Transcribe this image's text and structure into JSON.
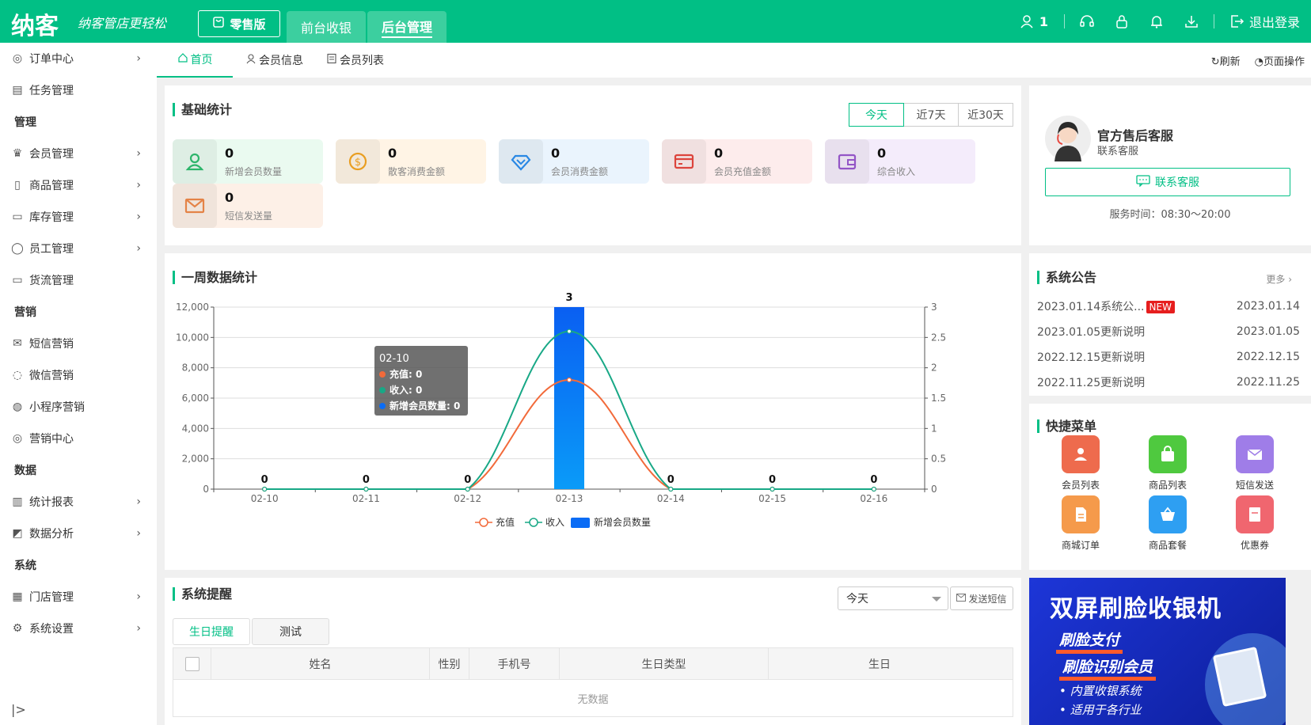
{
  "header": {
    "logo": "纳客",
    "slogan": "纳客管店更轻松",
    "edition": "零售版",
    "nav": [
      "前台收银",
      "后台管理"
    ],
    "user_count": "1",
    "logout": "退出登录"
  },
  "sidebar": {
    "items": [
      {
        "type": "item",
        "label": "订单中心",
        "arrow": true,
        "icon": "globe-icon"
      },
      {
        "type": "item",
        "label": "任务管理",
        "arrow": false,
        "icon": "task-icon"
      },
      {
        "type": "group",
        "label": "管理"
      },
      {
        "type": "item",
        "label": "会员管理",
        "arrow": true,
        "icon": "crown-icon"
      },
      {
        "type": "item",
        "label": "商品管理",
        "arrow": true,
        "icon": "goods-icon"
      },
      {
        "type": "item",
        "label": "库存管理",
        "arrow": true,
        "icon": "inventory-icon"
      },
      {
        "type": "item",
        "label": "员工管理",
        "arrow": true,
        "icon": "staff-icon"
      },
      {
        "type": "item",
        "label": "货流管理",
        "arrow": false,
        "icon": "truck-icon"
      },
      {
        "type": "group",
        "label": "营销"
      },
      {
        "type": "item",
        "label": "短信营销",
        "arrow": false,
        "icon": "mail-icon"
      },
      {
        "type": "item",
        "label": "微信营销",
        "arrow": false,
        "icon": "wechat-icon"
      },
      {
        "type": "item",
        "label": "小程序营销",
        "arrow": false,
        "icon": "miniapp-icon"
      },
      {
        "type": "item",
        "label": "营销中心",
        "arrow": false,
        "icon": "target-icon"
      },
      {
        "type": "group",
        "label": "数据"
      },
      {
        "type": "item",
        "label": "统计报表",
        "arrow": true,
        "icon": "bar-chart-icon"
      },
      {
        "type": "item",
        "label": "数据分析",
        "arrow": true,
        "icon": "analysis-icon"
      },
      {
        "type": "group",
        "label": "系统"
      },
      {
        "type": "item",
        "label": "门店管理",
        "arrow": true,
        "icon": "store-icon"
      },
      {
        "type": "item",
        "label": "系统设置",
        "arrow": true,
        "icon": "gear-icon"
      }
    ]
  },
  "tabs": {
    "home": "首页",
    "member_info": "会员信息",
    "member_list": "会员列表",
    "refresh": "刷新",
    "page_ops": "页面操作"
  },
  "basic_stats": {
    "title": "基础统计",
    "ranges": [
      "今天",
      "近7天",
      "近30天"
    ],
    "active_range": "今天",
    "items": [
      {
        "value": "0",
        "label": "新增会员数量",
        "color": "#2fbf71",
        "bg": "#eafaf0"
      },
      {
        "value": "0",
        "label": "散客消费金额",
        "color": "#f5a623",
        "bg": "#fff4e5"
      },
      {
        "value": "0",
        "label": "会员消费金额",
        "color": "#2b8ff0",
        "bg": "#eaf4fd"
      },
      {
        "value": "0",
        "label": "会员充值金额",
        "color": "#e8483f",
        "bg": "#fdecec"
      },
      {
        "value": "0",
        "label": "综合收入",
        "color": "#9b59d0",
        "bg": "#f4ecfb"
      },
      {
        "value": "0",
        "label": "短信发送量",
        "color": "#f08a4b",
        "bg": "#fdf0e7"
      }
    ]
  },
  "service": {
    "title": "官方售后客服",
    "subtitle": "联系客服",
    "button": "联系客服",
    "hours": "服务时间：08:30～20:00"
  },
  "chart_data": {
    "type": "bar",
    "title": "一周数据统计",
    "categories": [
      "02-10",
      "02-11",
      "02-12",
      "02-13",
      "02-14",
      "02-15",
      "02-16"
    ],
    "series": [
      {
        "name": "充值",
        "kind": "line",
        "axis": "left",
        "color": "#f26a3a",
        "values": [
          0,
          0,
          0,
          7200,
          0,
          0,
          0
        ]
      },
      {
        "name": "收入",
        "kind": "line",
        "axis": "left",
        "color": "#18a886",
        "values": [
          0,
          0,
          0,
          10400,
          0,
          0,
          0
        ]
      },
      {
        "name": "新增会员数量",
        "kind": "bar",
        "axis": "right",
        "color": "#0a6cf5",
        "values": [
          0,
          0,
          0,
          3,
          0,
          0,
          0
        ]
      }
    ],
    "ylim_left": [
      0,
      12000
    ],
    "yticks_left": [
      "0",
      "2,000",
      "4,000",
      "6,000",
      "8,000",
      "10,000",
      "12,000"
    ],
    "ylim_right": [
      0,
      3
    ],
    "yticks_right": [
      "0",
      "0.5",
      "1",
      "1.5",
      "2",
      "2.5",
      "3"
    ],
    "grid": true,
    "legend": "bottom",
    "tooltip": {
      "title": "02-10",
      "rows": [
        "充值: 0",
        "收入: 0",
        "新增会员数量: 0"
      ]
    }
  },
  "notices": {
    "title": "系统公告",
    "more": "更多 ›",
    "new_badge": "NEW",
    "items": [
      {
        "title": "2023.01.14系统公...",
        "date": "2023.01.14",
        "is_new": true
      },
      {
        "title": "2023.01.05更新说明",
        "date": "2023.01.05",
        "is_new": false
      },
      {
        "title": "2022.12.15更新说明",
        "date": "2022.12.15",
        "is_new": false
      },
      {
        "title": "2022.11.25更新说明",
        "date": "2022.11.25",
        "is_new": false
      }
    ]
  },
  "quick_menu": {
    "title": "快捷菜单",
    "items": [
      {
        "label": "会员列表",
        "color": "#ee6b4d"
      },
      {
        "label": "商品列表",
        "color": "#4fc93f"
      },
      {
        "label": "短信发送",
        "color": "#9f7de8"
      },
      {
        "label": "商城订单",
        "color": "#f59a4b"
      },
      {
        "label": "商品套餐",
        "color": "#2e9ff2"
      },
      {
        "label": "优惠券",
        "color": "#f0666f"
      }
    ]
  },
  "reminders": {
    "title": "系统提醒",
    "select_value": "今天",
    "sms_button": "发送短信",
    "subtabs": [
      "生日提醒",
      "测试"
    ],
    "columns": [
      "姓名",
      "性别",
      "手机号",
      "生日类型",
      "生日"
    ],
    "empty": "无数据"
  },
  "banner": {
    "title": "双屏刷脸收银机",
    "line1": "刷脸支付",
    "line2": "刷脸识别会员",
    "line3": "• 内置收银系统",
    "line4": "• 适用于各行业"
  }
}
